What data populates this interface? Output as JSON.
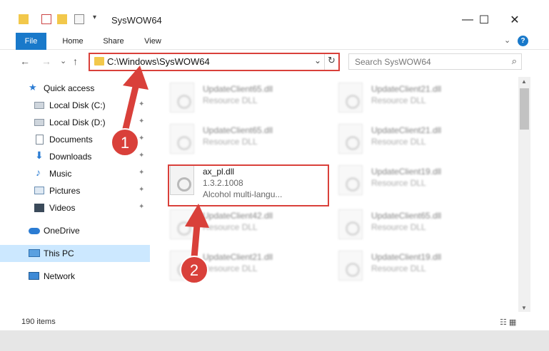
{
  "window": {
    "title": "SysWOW64",
    "minimize_glyph": "—",
    "maximize_glyph": "☐",
    "close_glyph": "✕"
  },
  "ribbon": {
    "tabs": [
      "File",
      "Home",
      "Share",
      "View"
    ],
    "expand_glyph": "⌄",
    "help_glyph": "?"
  },
  "nav": {
    "back_glyph": "←",
    "forward_glyph": "→",
    "recent_glyph": "⌄",
    "up_glyph": "↑"
  },
  "address": {
    "path": "C:\\Windows\\SysWOW64",
    "dropdown_glyph": "⌄",
    "refresh_glyph": "↻"
  },
  "search": {
    "placeholder": "Search SysWOW64",
    "icon_glyph": "⌕"
  },
  "sidebar": {
    "items": [
      {
        "label": "Quick access",
        "icon": "star-icon"
      },
      {
        "label": "Local Disk (C:)",
        "icon": "drive-icon",
        "pinned": true
      },
      {
        "label": "Local Disk (D:)",
        "icon": "drive-icon",
        "pinned": true
      },
      {
        "label": "Documents",
        "icon": "document-icon",
        "pinned": true
      },
      {
        "label": "Downloads",
        "icon": "download-icon",
        "pinned": true
      },
      {
        "label": "Music",
        "icon": "music-icon",
        "pinned": true
      },
      {
        "label": "Pictures",
        "icon": "pictures-icon",
        "pinned": true
      },
      {
        "label": "Videos",
        "icon": "videos-icon",
        "pinned": true
      },
      {
        "label": "OneDrive",
        "icon": "cloud-icon"
      },
      {
        "label": "This PC",
        "icon": "computer-icon",
        "selected": true
      },
      {
        "label": "Network",
        "icon": "network-icon"
      }
    ],
    "pin_glyph": "📌"
  },
  "files": [
    {
      "name": "UpdateClient65.dll",
      "sub1": "Resource DLL",
      "sub2": "",
      "blurred": true
    },
    {
      "name": "UpdateClient21.dll",
      "sub1": "Resource DLL",
      "sub2": "",
      "blurred": true
    },
    {
      "name": "UpdateClient65.dll",
      "sub1": "Resource DLL",
      "sub2": "",
      "blurred": true
    },
    {
      "name": "UpdateClient21.dll",
      "sub1": "Resource DLL",
      "sub2": "",
      "blurred": true
    },
    {
      "name": "ax_pl.dll",
      "sub1": "1.3.2.1008",
      "sub2": "Alcohol multi-langu...",
      "blurred": false
    },
    {
      "name": "UpdateClient19.dll",
      "sub1": "Resource DLL",
      "sub2": "",
      "blurred": true
    },
    {
      "name": "UpdateClient42.dll",
      "sub1": "Resource DLL",
      "sub2": "",
      "blurred": true
    },
    {
      "name": "UpdateClient65.dll",
      "sub1": "Resource DLL",
      "sub2": "",
      "blurred": true
    },
    {
      "name": "UpdateClient21.dll",
      "sub1": "Resource DLL",
      "sub2": "",
      "blurred": true
    },
    {
      "name": "UpdateClient19.dll",
      "sub1": "Resource DLL",
      "sub2": "",
      "blurred": true
    }
  ],
  "status": {
    "item_count": "190 items",
    "view_glyphs": "☷ ▦"
  },
  "scroll": {
    "up_glyph": "▲",
    "down_glyph": "▼"
  },
  "annotations": {
    "step1": "1",
    "step2": "2",
    "color": "#d9403a"
  }
}
